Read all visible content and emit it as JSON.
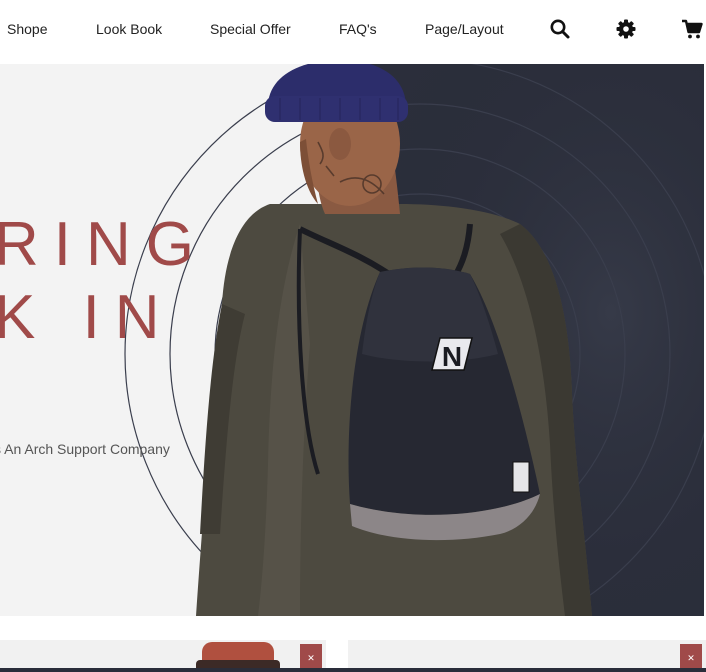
{
  "nav": {
    "links": [
      "Shope",
      "Look Book",
      "Special Offer",
      "FAQ's",
      "Page/Layout"
    ],
    "icons": [
      "search-icon",
      "gear-icon",
      "cart-icon"
    ]
  },
  "hero": {
    "title_line1": "RING",
    "title_line2": "K IN",
    "tagline": "s An Arch Support Company",
    "backpack_logo": "N",
    "colors": {
      "accent": "#a04a49",
      "dark_panel": "#2b2e3b",
      "light_panel": "#f3f3f3"
    }
  },
  "products": {
    "close_glyph": "✕"
  }
}
